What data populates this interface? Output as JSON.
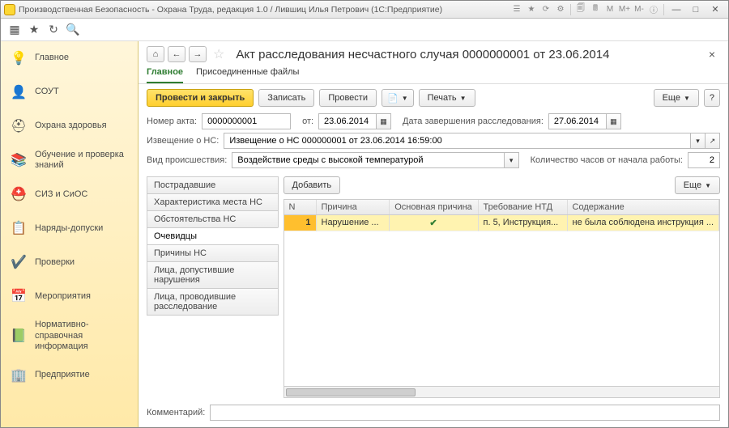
{
  "window": {
    "title": "Производственная Безопасность - Охрана Труда, редакция 1.0 / Лившиц Илья Петрович  (1С:Предприятие)",
    "m_buttons": [
      "M",
      "M+",
      "M-"
    ]
  },
  "sidebar": {
    "items": [
      {
        "label": "Главное",
        "icon": "home-lamp"
      },
      {
        "label": "СОУТ",
        "icon": "sout"
      },
      {
        "label": "Охрана здоровья",
        "icon": "medkit"
      },
      {
        "label": "Обучение и проверка знаний",
        "icon": "books"
      },
      {
        "label": "СИЗ и СиОС",
        "icon": "helmet"
      },
      {
        "label": "Наряды-допуски",
        "icon": "permit"
      },
      {
        "label": "Проверки",
        "icon": "check"
      },
      {
        "label": "Мероприятия",
        "icon": "events"
      },
      {
        "label": "Нормативно-справочная информация",
        "icon": "reference"
      },
      {
        "label": "Предприятие",
        "icon": "enterprise"
      }
    ]
  },
  "doc": {
    "title": "Акт расследования несчастного случая 0000000001 от 23.06.2014",
    "tabs": {
      "main": "Главное",
      "files": "Присоединенные файлы"
    },
    "buttons": {
      "post_close": "Провести и закрыть",
      "save": "Записать",
      "post": "Провести",
      "print": "Печать",
      "more": "Еще"
    },
    "fields": {
      "num_label": "Номер акта:",
      "num_value": "0000000001",
      "from_label": "от:",
      "from_value": "23.06.2014",
      "end_label": "Дата завершения расследования:",
      "end_value": "27.06.2014",
      "notice_label": "Извещение о НС:",
      "notice_value": "Извещение о НС 000000001 от 23.06.2014 16:59:00",
      "kind_label": "Вид происшествия:",
      "kind_value": "Воздействие среды с высокой температурой",
      "hours_label": "Количество часов от начала работы:",
      "hours_value": "2",
      "comment_label": "Комментарий:",
      "comment_value": ""
    },
    "group_tabs": [
      "Пострадавшие",
      "Характеристика места НС",
      "Обстоятельства НС",
      "Очевидцы",
      "Причины НС",
      "Лица, допустившие нарушения",
      "Лица, проводившие расследование"
    ],
    "group_active": 3,
    "grid": {
      "add": "Добавить",
      "more": "Еще",
      "columns": {
        "n": "N",
        "reason": "Причина",
        "main": "Основная причина",
        "req": "Требование НТД",
        "desc": "Содержание"
      },
      "rows": [
        {
          "n": "1",
          "reason": "Нарушение ...",
          "main": true,
          "req": "п. 5, Инструкция...",
          "desc": "не была соблюдена инструкция ..."
        }
      ]
    }
  }
}
